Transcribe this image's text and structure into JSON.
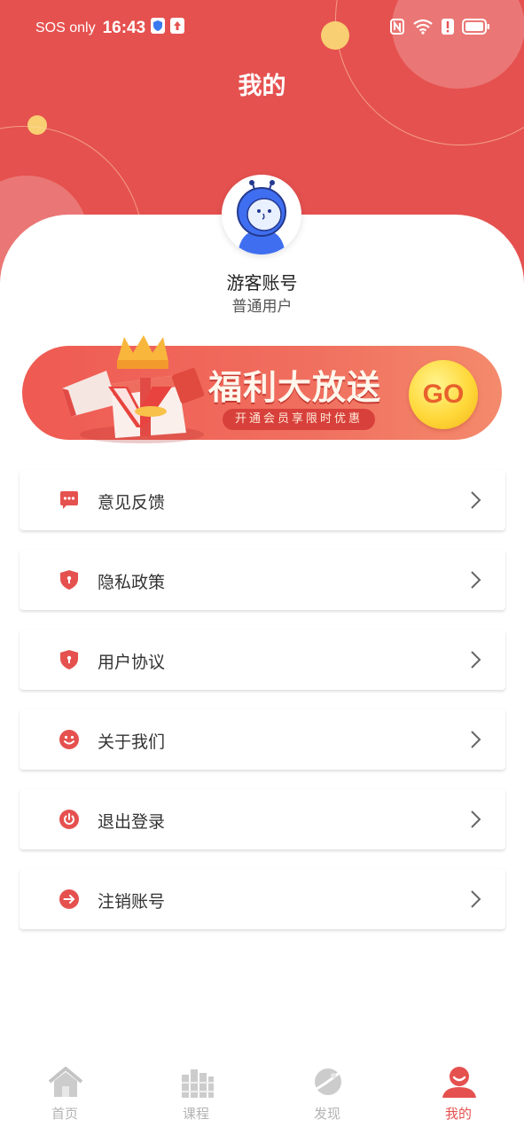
{
  "status_bar": {
    "carrier": "SOS only",
    "time": "16:43"
  },
  "header": {
    "title": "我的"
  },
  "profile": {
    "name": "游客账号",
    "type": "普通用户"
  },
  "banner": {
    "title": "福利大放送",
    "subtitle": "开通会员享限时优惠",
    "button": "GO"
  },
  "menu": {
    "items": [
      {
        "label": "意见反馈",
        "icon": "feedback-icon"
      },
      {
        "label": "隐私政策",
        "icon": "shield-icon"
      },
      {
        "label": "用户协议",
        "icon": "shield-icon"
      },
      {
        "label": "关于我们",
        "icon": "smile-icon"
      },
      {
        "label": "退出登录",
        "icon": "power-icon"
      },
      {
        "label": "注销账号",
        "icon": "arrow-right-circle-icon"
      }
    ]
  },
  "tabbar": {
    "tabs": [
      {
        "label": "首页",
        "icon": "home-icon"
      },
      {
        "label": "课程",
        "icon": "books-icon"
      },
      {
        "label": "发现",
        "icon": "planet-icon"
      },
      {
        "label": "我的",
        "icon": "user-icon",
        "active": true
      }
    ]
  },
  "colors": {
    "primary": "#e5514f",
    "inactive": "#b3b3b3"
  }
}
